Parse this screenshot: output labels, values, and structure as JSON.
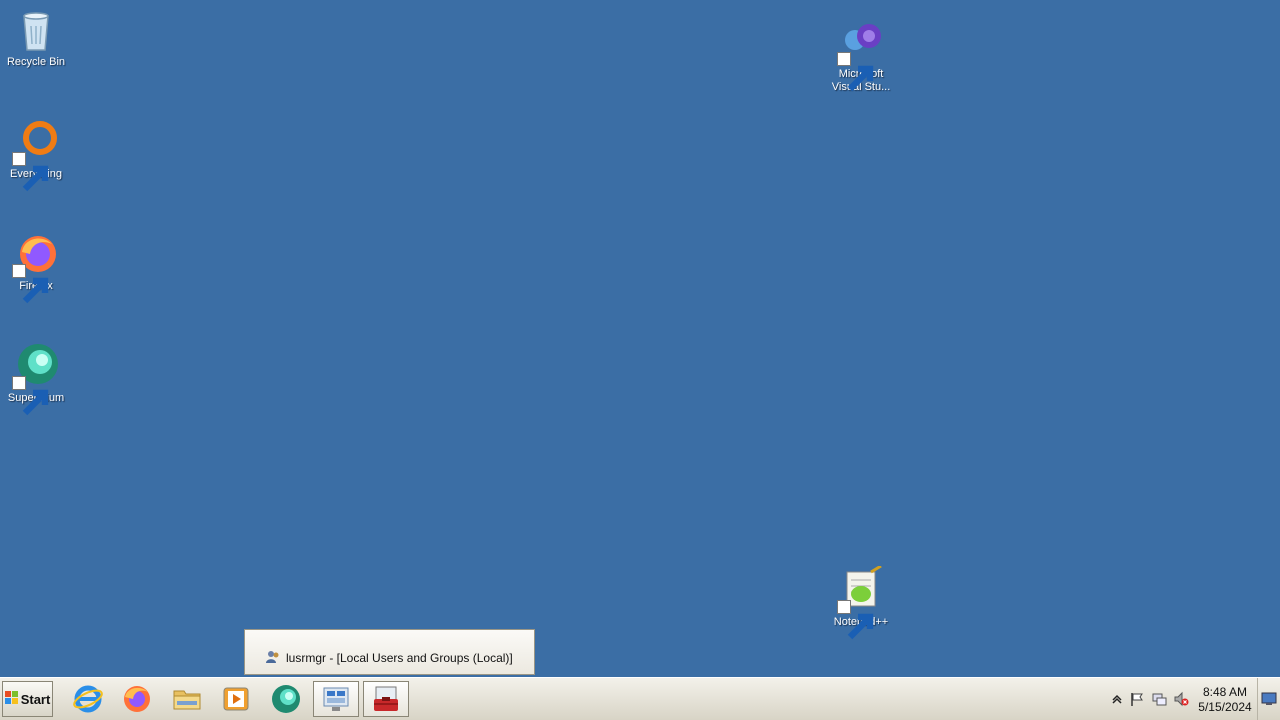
{
  "desktop": {
    "icons": [
      {
        "label": "Recycle Bin",
        "icon": "recycle-bin-icon"
      },
      {
        "label": "Everything",
        "icon": "everything-icon"
      },
      {
        "label": "Firefox",
        "icon": "firefox-icon"
      },
      {
        "label": "Supermium",
        "icon": "supermium-icon"
      },
      {
        "label": "Microsoft Visual Stu...",
        "icon": "visual-studio-icon"
      },
      {
        "label": "Notepad++",
        "icon": "notepadpp-icon"
      }
    ]
  },
  "taskbar": {
    "start_label": "Start",
    "pinned": [
      {
        "name": "internet-explorer-icon"
      },
      {
        "name": "firefox-icon"
      },
      {
        "name": "file-explorer-icon"
      },
      {
        "name": "media-player-icon"
      },
      {
        "name": "supermium-icon"
      },
      {
        "name": "server-manager-icon"
      },
      {
        "name": "computer-management-icon"
      }
    ],
    "clock": {
      "time": "8:48 AM",
      "date": "5/15/2024"
    },
    "tray_icons": [
      "show-hidden-icons",
      "action-center-flag-icon",
      "network-icon",
      "volume-muted-icon"
    ]
  },
  "thumbnail_popup": {
    "title": "lusrmgr - [Local Users and Groups (Local)]"
  },
  "colors": {
    "desktop_background": "#3b6ea5"
  }
}
